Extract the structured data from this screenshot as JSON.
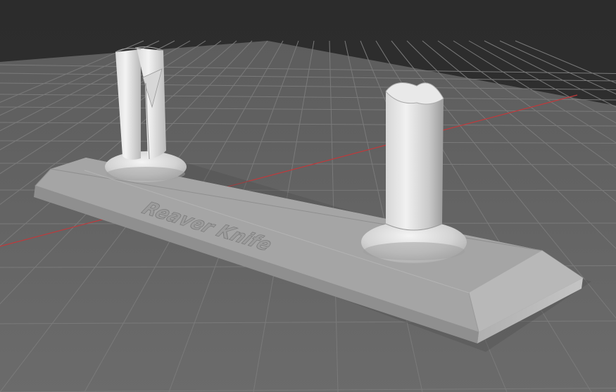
{
  "scene": {
    "background_color": "#2f2f2f",
    "floor_color": "#666666",
    "grid_line_color": "#7c7c7c",
    "x_axis_color": "#c0393b",
    "model_color": "#bdbdbd"
  },
  "model": {
    "engraving_text": "Reaver Knife"
  }
}
